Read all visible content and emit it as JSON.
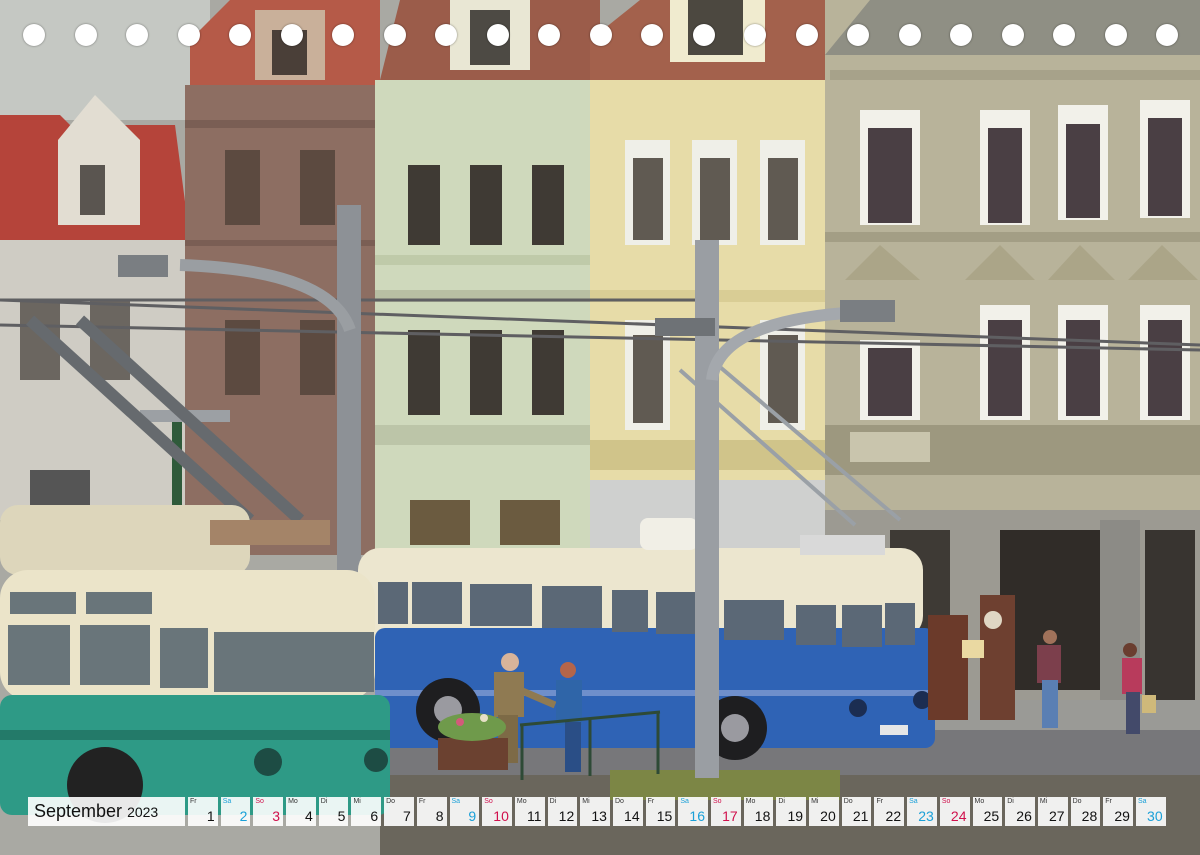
{
  "calendar": {
    "month": "September",
    "year": "2023",
    "days": [
      {
        "dow": "Fr",
        "num": "1",
        "kind": "weekday"
      },
      {
        "dow": "Sa",
        "num": "2",
        "kind": "sat"
      },
      {
        "dow": "So",
        "num": "3",
        "kind": "sun"
      },
      {
        "dow": "Mo",
        "num": "4",
        "kind": "weekday"
      },
      {
        "dow": "Di",
        "num": "5",
        "kind": "weekday"
      },
      {
        "dow": "Mi",
        "num": "6",
        "kind": "weekday"
      },
      {
        "dow": "Do",
        "num": "7",
        "kind": "weekday"
      },
      {
        "dow": "Fr",
        "num": "8",
        "kind": "weekday"
      },
      {
        "dow": "Sa",
        "num": "9",
        "kind": "sat"
      },
      {
        "dow": "So",
        "num": "10",
        "kind": "sun"
      },
      {
        "dow": "Mo",
        "num": "11",
        "kind": "weekday"
      },
      {
        "dow": "Di",
        "num": "12",
        "kind": "weekday"
      },
      {
        "dow": "Mi",
        "num": "13",
        "kind": "weekday"
      },
      {
        "dow": "Do",
        "num": "14",
        "kind": "weekday"
      },
      {
        "dow": "Fr",
        "num": "15",
        "kind": "weekday"
      },
      {
        "dow": "Sa",
        "num": "16",
        "kind": "sat"
      },
      {
        "dow": "So",
        "num": "17",
        "kind": "sun"
      },
      {
        "dow": "Mo",
        "num": "18",
        "kind": "weekday"
      },
      {
        "dow": "Di",
        "num": "19",
        "kind": "weekday"
      },
      {
        "dow": "Mi",
        "num": "20",
        "kind": "weekday"
      },
      {
        "dow": "Do",
        "num": "21",
        "kind": "weekday"
      },
      {
        "dow": "Fr",
        "num": "22",
        "kind": "weekday"
      },
      {
        "dow": "Sa",
        "num": "23",
        "kind": "sat"
      },
      {
        "dow": "So",
        "num": "24",
        "kind": "sun"
      },
      {
        "dow": "Mo",
        "num": "25",
        "kind": "weekday"
      },
      {
        "dow": "Di",
        "num": "26",
        "kind": "weekday"
      },
      {
        "dow": "Mi",
        "num": "27",
        "kind": "weekday"
      },
      {
        "dow": "Do",
        "num": "28",
        "kind": "weekday"
      },
      {
        "dow": "Fr",
        "num": "29",
        "kind": "weekday"
      },
      {
        "dow": "Sa",
        "num": "30",
        "kind": "sat"
      }
    ]
  },
  "colors": {
    "saturday": "#1aa0d8",
    "sunday": "#d0104c",
    "bus_blue": "#2f63b5",
    "bus_cream": "#ece6cf",
    "bus_green": "#2e9a86"
  },
  "spiral_holes": 23
}
